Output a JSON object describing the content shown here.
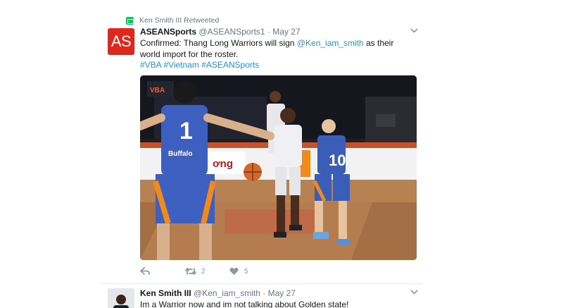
{
  "retweet": {
    "label": "Ken Smith III Retweeted"
  },
  "tweet1": {
    "avatar_text": "AS",
    "name": "ASEANSports",
    "handle": "@ASEANSports1",
    "separator": "·",
    "date": "May 27",
    "text_before": "Confirmed: Thang Long Warriors will sign ",
    "mention": "@Ken_iam_smith",
    "text_after": "  as their world import for the roster.",
    "hashtags": "#VBA #Vietnam #ASEANSports",
    "retweet_count": "2",
    "like_count": "5",
    "photo": {
      "jersey_front": "1",
      "jersey_right": "10",
      "sponsor": "Buffalo",
      "banner": "ơng"
    }
  },
  "tweet2": {
    "name": "Ken Smith III",
    "handle": "@Ken_iam_smith",
    "separator": "·",
    "date": "May 27",
    "text": "Im a Warrior now and im not talking about Golden state!"
  },
  "icons": [
    "retweet-icon",
    "chevron-down-icon",
    "reply-icon",
    "like-icon"
  ],
  "colors": {
    "link": "#1b95e0",
    "muted": "#657786",
    "avatar": "#e0261d",
    "retweet_green": "#17bf63"
  }
}
